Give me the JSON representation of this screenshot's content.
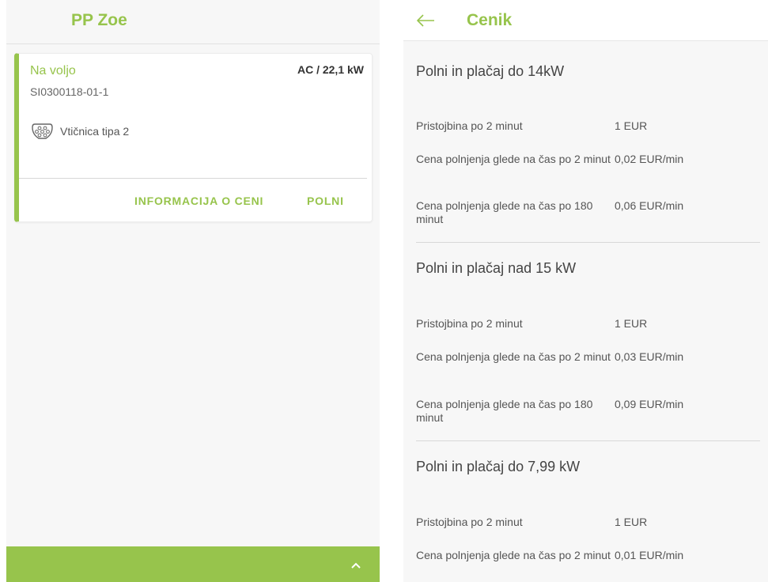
{
  "left_panel": {
    "title": "PP Zoe",
    "card": {
      "status": "Na voljo",
      "power": "AC / 22,1 kW",
      "station_id": "SI0300118-01-1",
      "connector_label": "Vtičnica tipa 2",
      "price_info_button": "INFORMACIJA O CENI",
      "charge_button": "POLNI"
    },
    "bottom_icon": "chevron-up-icon"
  },
  "right_panel": {
    "title": "Cenik",
    "back_icon": "arrow-left-icon",
    "sections": [
      {
        "title": "Polni in plačaj do 14kW",
        "rows": [
          {
            "label": "Pristojbina po 2 minut",
            "value": "1 EUR"
          },
          {
            "label": "Cena polnjenja glede na čas  po 2 minut",
            "value": "0,02 EUR/min"
          },
          {
            "label": "Cena polnjenja glede na čas  po 180 minut",
            "value": "0,06 EUR/min"
          }
        ]
      },
      {
        "title": "Polni in plačaj nad 15 kW",
        "rows": [
          {
            "label": "Pristojbina po 2 minut",
            "value": "1 EUR"
          },
          {
            "label": "Cena polnjenja glede na čas  po 2 minut",
            "value": "0,03 EUR/min"
          },
          {
            "label": "Cena polnjenja glede na čas  po 180 minut",
            "value": "0,09 EUR/min"
          }
        ]
      },
      {
        "title": "Polni in plačaj do 7,99 kW",
        "rows": [
          {
            "label": "Pristojbina po 2 minut",
            "value": "1 EUR"
          },
          {
            "label": "Cena polnjenja glede na čas  po 2 minut",
            "value": "0,01 EUR/min"
          }
        ]
      }
    ]
  },
  "colors": {
    "accent": "#97c44c",
    "text": "#555555",
    "background": "#f7f7f7"
  }
}
